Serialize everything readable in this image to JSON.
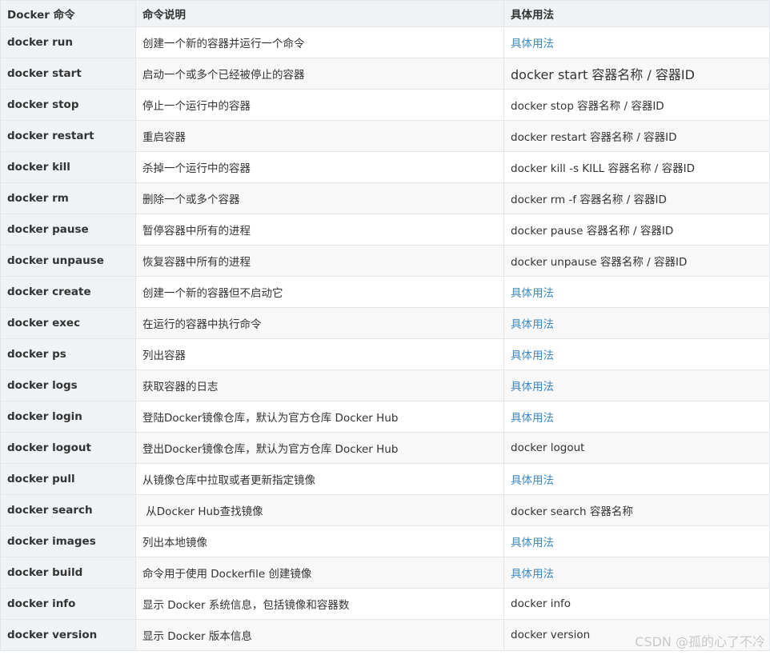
{
  "table": {
    "headers": [
      "Docker 命令",
      "命令说明",
      "具体用法"
    ],
    "rows": [
      {
        "command": "docker run",
        "description": "创建一个新的容器并运行一个命令",
        "usage": "具体用法",
        "usage_is_link": true
      },
      {
        "command": "docker start",
        "description": "启动一个或多个已经被停止的容器",
        "usage": "docker start 容器名称 / 容器ID",
        "usage_is_link": false
      },
      {
        "command": "docker stop",
        "description": "停止一个运行中的容器",
        "usage": "docker stop 容器名称 / 容器ID",
        "usage_is_link": false
      },
      {
        "command": "docker restart",
        "description": "重启容器",
        "usage": "docker restart 容器名称 / 容器ID",
        "usage_is_link": false
      },
      {
        "command": "docker kill",
        "description": "杀掉一个运行中的容器",
        "usage": "docker kill -s KILL 容器名称 / 容器ID",
        "usage_is_link": false
      },
      {
        "command": "docker rm",
        "description": "删除一个或多个容器",
        "usage": "docker rm -f 容器名称 / 容器ID",
        "usage_is_link": false
      },
      {
        "command": "docker pause",
        "description": "暂停容器中所有的进程",
        "usage": "docker pause 容器名称 / 容器ID",
        "usage_is_link": false
      },
      {
        "command": "docker unpause",
        "description": "恢复容器中所有的进程",
        "usage": "docker unpause 容器名称 / 容器ID",
        "usage_is_link": false
      },
      {
        "command": "docker create",
        "description": "创建一个新的容器但不启动它",
        "usage": "具体用法",
        "usage_is_link": true
      },
      {
        "command": "docker exec",
        "description": "在运行的容器中执行命令",
        "usage": "具体用法",
        "usage_is_link": true
      },
      {
        "command": "docker ps",
        "description": "列出容器",
        "usage": "具体用法",
        "usage_is_link": true
      },
      {
        "command": "docker logs",
        "description": "获取容器的日志",
        "usage": "具体用法",
        "usage_is_link": true
      },
      {
        "command": "docker login",
        "description": "登陆Docker镜像仓库，默认为官方仓库 Docker Hub",
        "usage": "具体用法",
        "usage_is_link": true
      },
      {
        "command": "docker logout",
        "description": "登出Docker镜像仓库，默认为官方仓库 Docker Hub",
        "usage": "docker logout",
        "usage_is_link": false
      },
      {
        "command": "docker pull",
        "description": "从镜像仓库中拉取或者更新指定镜像",
        "usage": "具体用法",
        "usage_is_link": true
      },
      {
        "command": "docker search",
        "description": " 从Docker Hub查找镜像",
        "usage": "docker search 容器名称",
        "usage_is_link": false
      },
      {
        "command": "docker images",
        "description": "列出本地镜像",
        "usage": "具体用法",
        "usage_is_link": true
      },
      {
        "command": "docker build",
        "description": "命令用于使用 Dockerfile 创建镜像",
        "usage": "具体用法",
        "usage_is_link": true
      },
      {
        "command": "docker info",
        "description": "显示 Docker 系统信息，包括镜像和容器数",
        "usage": "docker info",
        "usage_is_link": false
      },
      {
        "command": "docker version",
        "description": "显示 Docker 版本信息",
        "usage": "docker version",
        "usage_is_link": false
      }
    ]
  },
  "watermark": "CSDN @孤的心了不冷",
  "colors": {
    "link": "#3f88c5",
    "header_bg": "#eff3f5",
    "text": "#333333"
  }
}
